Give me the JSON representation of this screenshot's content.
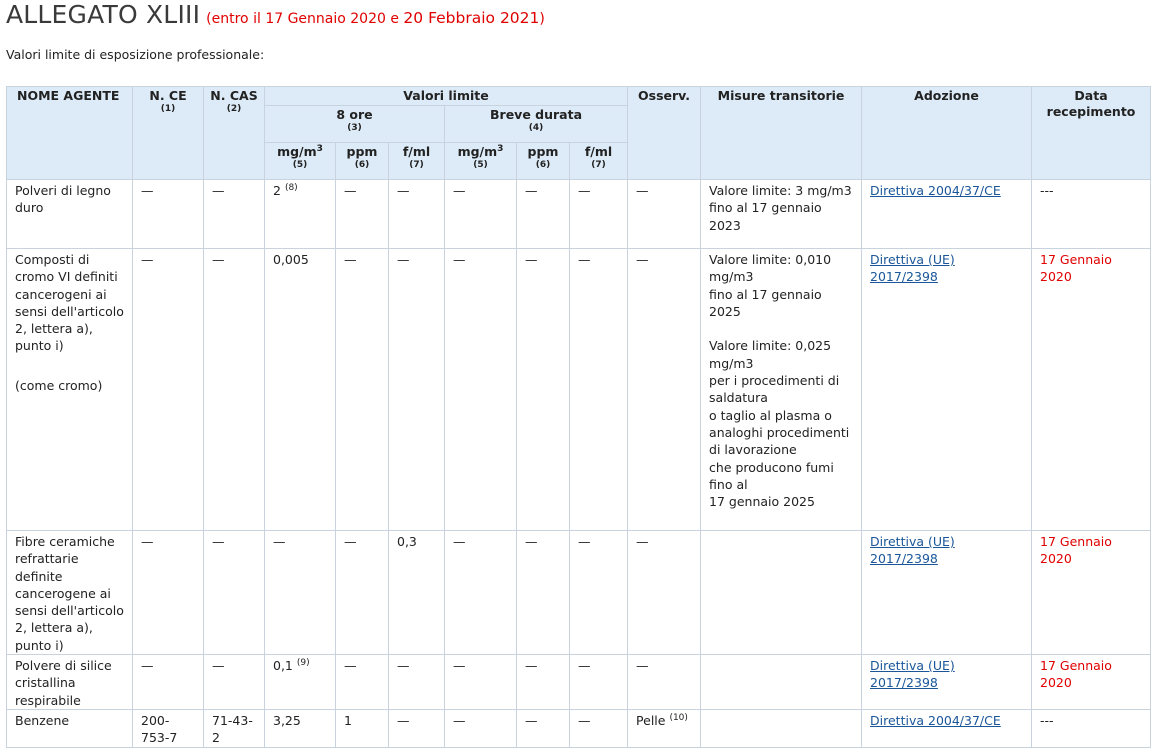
{
  "header": {
    "title": "ALLEGATO XLIII",
    "paren_open": "(entro il ",
    "date1": "17 Gennaio 2020",
    "conj": " e ",
    "date2": "20 Febbraio 2021",
    "paren_close": ")"
  },
  "intro": "Valori limite di esposizione professionale:",
  "columns": {
    "nome_agente": "NOME AGENTE",
    "n_ce": "N. CE",
    "n_ce_note": "(1)",
    "n_cas": "N. CAS",
    "n_cas_note": "(2)",
    "valori_limite": "Valori limite",
    "otto_ore": "8 ore",
    "otto_ore_note": "(3)",
    "breve_durata": "Breve durata",
    "breve_durata_note": "(4)",
    "mgm3": "mg/m",
    "mgm3_exp": "3",
    "mgm3_note": "(5)",
    "ppm": "ppm",
    "ppm_note": "(6)",
    "fml": "f/ml",
    "fml_note": "(7)",
    "osserv": "Osserv.",
    "misure": "Misure transitorie",
    "adozione": "Adozione",
    "data_recepimento": "Data recepimento"
  },
  "rows": [
    {
      "nome": [
        "Polveri di legno duro"
      ],
      "ce": "—",
      "cas": "—",
      "mg8": "2",
      "mg8_note": "(8)",
      "ppm8": "—",
      "fml8": "—",
      "mgb": "—",
      "ppmb": "—",
      "fmlb": "—",
      "osserv": "—",
      "misure": [
        "Valore limite: 3 mg/m3",
        "fino al 17 gennaio 2023"
      ],
      "adozione": "Direttiva 2004/37/CE",
      "data": "---"
    },
    {
      "nome": [
        "Composti di cromo VI definiti cancerogeni ai sensi dell'articolo 2, lettera a), punto i)",
        "",
        "(come cromo)"
      ],
      "ce": "—",
      "cas": "—",
      "mg8": "0,005",
      "ppm8": "—",
      "fml8": "—",
      "mgb": "—",
      "ppmb": "—",
      "fmlb": "—",
      "osserv": "—",
      "misure": [
        "Valore limite: 0,010 mg/m3",
        "fino al 17 gennaio 2025",
        "",
        "Valore limite: 0,025 mg/m3",
        "per i procedimenti di saldatura",
        "o taglio al plasma o analoghi procedimenti di lavorazione",
        "che producono fumi fino al",
        "17 gennaio 2025"
      ],
      "adozione": "Direttiva (UE) 2017/2398",
      "data": "17 Gennaio 2020"
    },
    {
      "nome": [
        "Fibre ceramiche refrattarie definite cancerogene ai sensi dell'articolo 2, lettera a), punto i)"
      ],
      "ce": "—",
      "cas": "—",
      "mg8": "—",
      "ppm8": "—",
      "fml8": "0,3",
      "mgb": "—",
      "ppmb": "—",
      "fmlb": "—",
      "osserv": "—",
      "misure": [],
      "adozione": "Direttiva (UE) 2017/2398",
      "data": "17 Gennaio 2020"
    },
    {
      "nome": [
        "Polvere di silice cristallina respirabile"
      ],
      "ce": "—",
      "cas": "—",
      "mg8": "0,1",
      "mg8_note": "(9)",
      "ppm8": "—",
      "fml8": "—",
      "mgb": "—",
      "ppmb": "—",
      "fmlb": "—",
      "osserv": "—",
      "misure": [],
      "adozione": "Direttiva (UE) 2017/2398",
      "data": "17 Gennaio 2020"
    },
    {
      "nome": [
        "Benzene"
      ],
      "ce": "200-753-7",
      "cas": "71-43-2",
      "mg8": "3,25",
      "ppm8": "1",
      "fml8": "—",
      "mgb": "—",
      "ppmb": "—",
      "fmlb": "—",
      "osserv": "Pelle",
      "osserv_note": "(10)",
      "misure": [],
      "adozione": "Direttiva 2004/37/CE",
      "data": "---"
    }
  ]
}
